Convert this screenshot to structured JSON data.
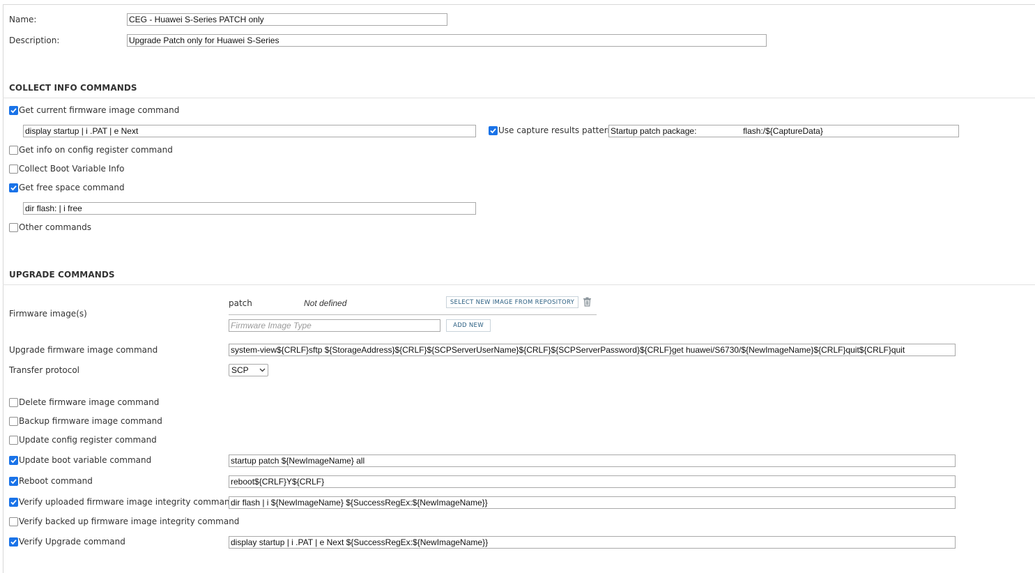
{
  "general": {
    "name_label": "Name:",
    "name_value": "CEG - Huawei S-Series PATCH only",
    "description_label": "Description:",
    "description_value": "Upgrade Patch only for Huawei S-Series"
  },
  "collect": {
    "title": "COLLECT INFO COMMANDS",
    "get_current_image": {
      "label": "Get current firmware image command",
      "checked": true,
      "value": "display startup | i .PAT | e Next"
    },
    "capture_pattern": {
      "label": "Use capture results pattern",
      "checked": true,
      "value": "Startup patch package:                    flash:/${CaptureData}"
    },
    "config_register": {
      "label": "Get info on config register command",
      "checked": false
    },
    "boot_variable": {
      "label": "Collect Boot Variable Info",
      "checked": false
    },
    "free_space": {
      "label": "Get free space command",
      "checked": true,
      "value": "dir flash: | i free"
    },
    "other": {
      "label": "Other commands",
      "checked": false
    }
  },
  "upgrade": {
    "title": "UPGRADE COMMANDS",
    "firmware_images_label": "Firmware image(s)",
    "image_type": "patch",
    "image_status": "Not defined",
    "select_button": "SELECT NEW IMAGE FROM REPOSITORY",
    "type_placeholder": "Firmware Image Type",
    "add_new_button": "ADD NEW",
    "upgrade_cmd_label": "Upgrade firmware image command",
    "upgrade_cmd_value": "system-view${CRLF}sftp ${StorageAddress}${CRLF}${SCPServerUserName}${CRLF}${SCPServerPassword}${CRLF}get huawei/S6730/${NewImageName}${CRLF}quit${CRLF}quit",
    "transfer_label": "Transfer protocol",
    "transfer_value": "SCP",
    "delete": {
      "label": "Delete firmware image command",
      "checked": false
    },
    "backup": {
      "label": "Backup firmware image command",
      "checked": false
    },
    "update_config": {
      "label": "Update config register command",
      "checked": false
    },
    "update_boot": {
      "label": "Update boot variable command",
      "checked": true,
      "value": "startup patch ${NewImageName} all"
    },
    "reboot": {
      "label": "Reboot command",
      "checked": true,
      "value": "reboot${CRLF}Y${CRLF}"
    },
    "verify_uploaded": {
      "label": "Verify uploaded firmware image integrity command",
      "checked": true,
      "value": "dir flash | i ${NewImageName} ${SuccessRegEx:${NewImageName}}"
    },
    "verify_backed": {
      "label": "Verify backed up firmware image integrity command",
      "checked": false
    },
    "verify_upgrade": {
      "label": "Verify Upgrade command",
      "checked": true,
      "value": "display startup | i .PAT | e Next ${SuccessRegEx:${NewImageName}}"
    }
  },
  "colors": {
    "accent": "#1a73e8",
    "button_text": "#2b5f82"
  },
  "icons": {
    "checkbox_check": "checkmark-icon",
    "delete": "trash-icon",
    "dropdown": "chevron-down-icon"
  }
}
